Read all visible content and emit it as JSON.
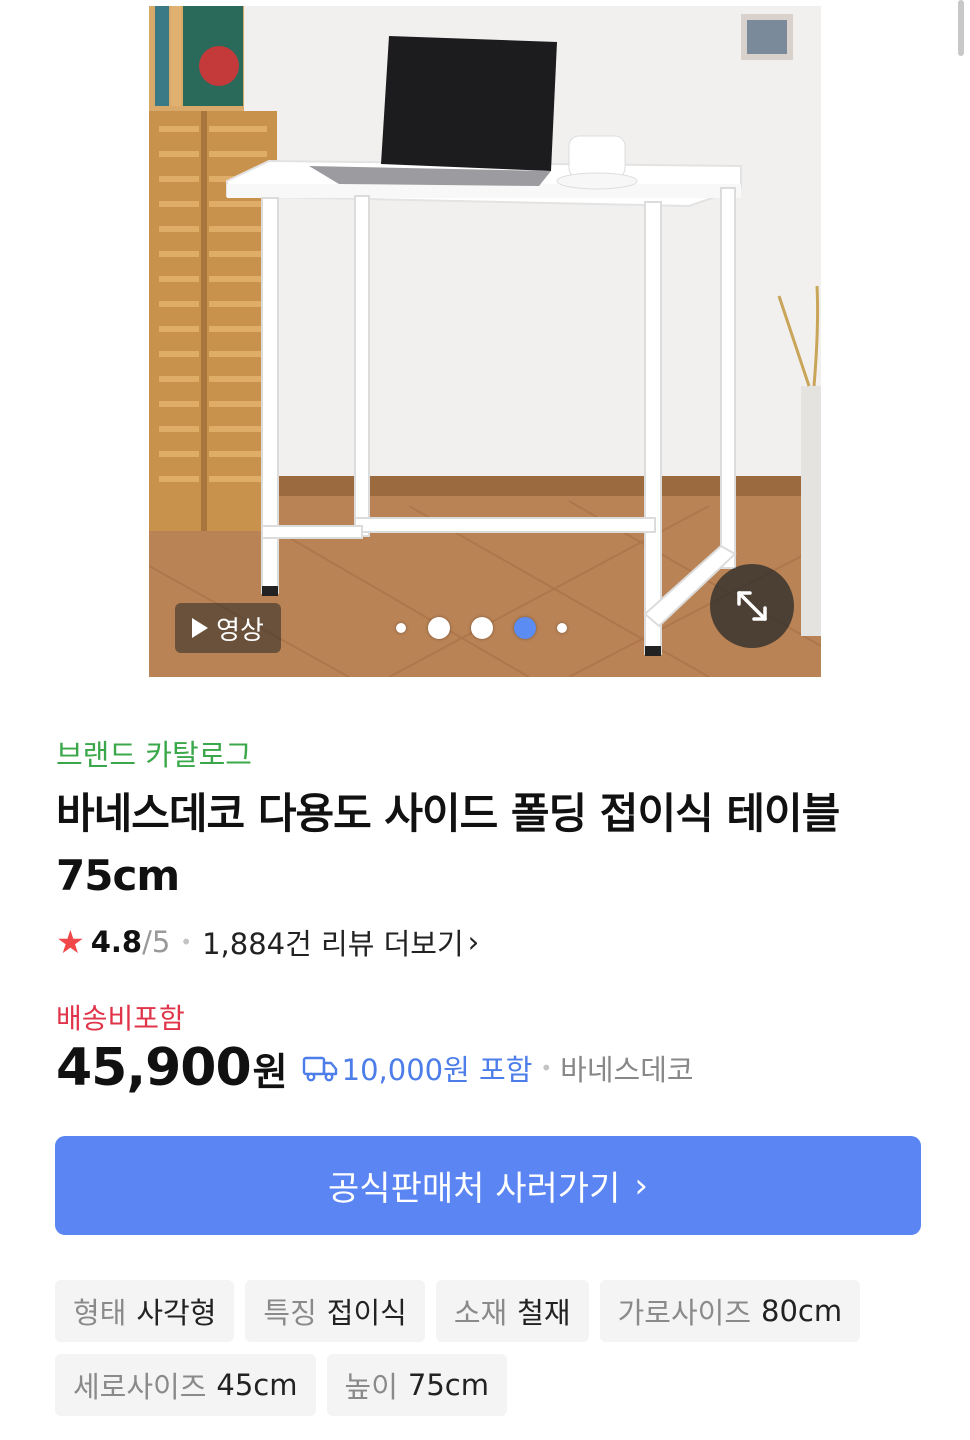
{
  "gallery": {
    "video_label": "영상",
    "slide_count": 5,
    "active_index": 3
  },
  "product": {
    "brand_catalog": "브랜드 카탈로그",
    "title": "바네스데코 다용도 사이드 폴딩 접이식 테이블 75cm",
    "rating": {
      "score": "4.8",
      "out_of": "/5",
      "separator": "•",
      "reviews": "1,884건 리뷰 더보기",
      "reviews_chevron": "›"
    },
    "shipping_label": "배송비포함",
    "price": "45,900",
    "currency": "원",
    "shipping_fee": "10,000원 포함",
    "seller_separator": "•",
    "seller": "바네스데코"
  },
  "buy_button": {
    "label": "공식판매처 사러가기",
    "chevron": "›"
  },
  "specs": [
    {
      "key": "형태",
      "value": "사각형"
    },
    {
      "key": "특징",
      "value": "접이식"
    },
    {
      "key": "소재",
      "value": "철재"
    },
    {
      "key": "가로사이즈",
      "value": "80cm"
    },
    {
      "key": "세로사이즈",
      "value": "45cm"
    },
    {
      "key": "높이",
      "value": "75cm"
    }
  ],
  "colors": {
    "accent": "#5b85f2",
    "brand_green": "#3aa84a",
    "sale_red": "#e0344a",
    "star": "#f04848",
    "shipping_blue": "#4c7de8"
  }
}
